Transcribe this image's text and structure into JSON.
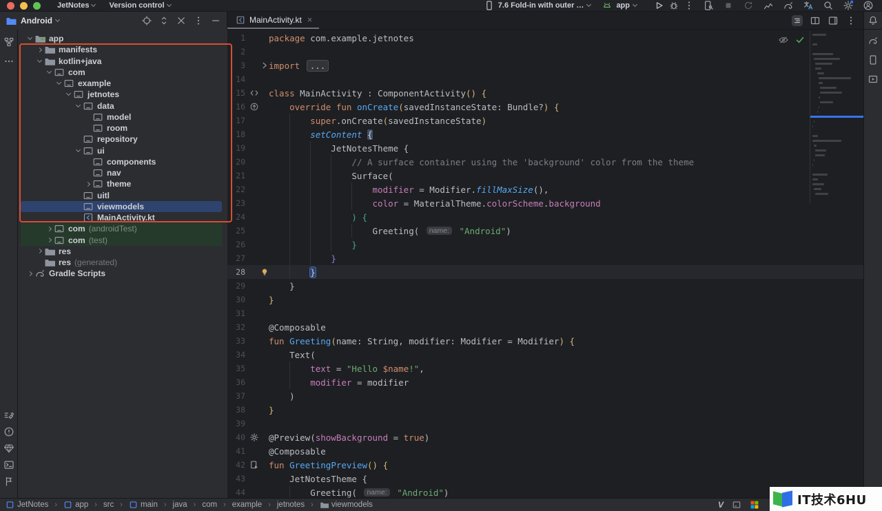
{
  "menubar": {
    "items": [
      "JetNotes",
      "Version control"
    ],
    "device_selector": "7.6 Fold-in with outer …",
    "run_config": "app"
  },
  "project_panel": {
    "title": "Android",
    "tree": [
      {
        "label": "app",
        "level": 0,
        "chev": "down",
        "icon": "app-folder",
        "bold": true
      },
      {
        "label": "manifests",
        "level": 1,
        "chev": "right",
        "icon": "folder"
      },
      {
        "label": "kotlin+java",
        "level": 1,
        "chev": "down",
        "icon": "folder"
      },
      {
        "label": "com",
        "level": 2,
        "chev": "down",
        "icon": "package"
      },
      {
        "label": "example",
        "level": 3,
        "chev": "down",
        "icon": "package"
      },
      {
        "label": "jetnotes",
        "level": 4,
        "chev": "down",
        "icon": "package"
      },
      {
        "label": "data",
        "level": 5,
        "chev": "down",
        "icon": "package"
      },
      {
        "label": "model",
        "level": 6,
        "icon": "package"
      },
      {
        "label": "room",
        "level": 6,
        "icon": "package"
      },
      {
        "label": "repository",
        "level": 5,
        "icon": "package"
      },
      {
        "label": "ui",
        "level": 5,
        "chev": "down",
        "icon": "package"
      },
      {
        "label": "components",
        "level": 6,
        "icon": "package"
      },
      {
        "label": "nav",
        "level": 6,
        "icon": "package"
      },
      {
        "label": "theme",
        "level": 6,
        "chev": "right",
        "icon": "package"
      },
      {
        "label": "uitl",
        "level": 5,
        "icon": "package"
      },
      {
        "label": "viewmodels",
        "level": 5,
        "icon": "package",
        "selected": true
      },
      {
        "label": "MainActivity.kt",
        "level": 5,
        "icon": "kotlin-file"
      },
      {
        "label": "com",
        "suffix": "(androidTest)",
        "level": 2,
        "chev": "right",
        "icon": "package",
        "test": true
      },
      {
        "label": "com",
        "suffix": "(test)",
        "level": 2,
        "chev": "right",
        "icon": "package",
        "test": true
      },
      {
        "label": "res",
        "level": 1,
        "chev": "right",
        "icon": "folder"
      },
      {
        "label": "res",
        "suffix": "(generated)",
        "level": 1,
        "icon": "folder"
      },
      {
        "label": "Gradle Scripts",
        "level": 0,
        "chev": "right",
        "icon": "gradle"
      }
    ]
  },
  "editor": {
    "tab_title": "MainActivity.kt",
    "current_line": "28",
    "lines": [
      {
        "n": "1",
        "tokens": [
          [
            "kw",
            "package"
          ],
          [
            "pl",
            " com.example.jetnotes"
          ]
        ]
      },
      {
        "n": "2",
        "tokens": []
      },
      {
        "n": "3",
        "gutter": "fold",
        "tokens": [
          [
            "kw",
            "import"
          ],
          [
            "pl",
            " "
          ],
          [
            "fold",
            "..."
          ]
        ]
      },
      {
        "n": "14",
        "tokens": []
      },
      {
        "n": "15",
        "gutter": "markup",
        "tokens": [
          [
            "kw",
            "class"
          ],
          [
            "pl",
            " MainActivity : ComponentActivity"
          ],
          [
            "y",
            "()"
          ],
          [
            "pl",
            " "
          ],
          [
            "y",
            "{"
          ]
        ]
      },
      {
        "n": "16",
        "gutter": "override",
        "tokens": [
          [
            "pl",
            "    "
          ],
          [
            "kw",
            "override"
          ],
          [
            "pl",
            " "
          ],
          [
            "kw",
            "fun"
          ],
          [
            "pl",
            " "
          ],
          [
            "def",
            "onCreate"
          ],
          [
            "y",
            "("
          ],
          [
            "pl",
            "savedInstanceState: Bundle?"
          ],
          [
            "y",
            ")"
          ],
          [
            "pl",
            " "
          ],
          [
            "y",
            "{"
          ]
        ]
      },
      {
        "n": "17",
        "tokens": [
          [
            "pl",
            "        "
          ],
          [
            "kw",
            "super"
          ],
          [
            "pl",
            ".onCreate"
          ],
          [
            "y",
            "("
          ],
          [
            "pl",
            "savedInstanceState"
          ],
          [
            "y",
            ")"
          ]
        ]
      },
      {
        "n": "18",
        "tokens": [
          [
            "pl",
            "        "
          ],
          [
            "ext",
            "setContent"
          ],
          [
            "pl",
            " "
          ],
          [
            "mb",
            "{"
          ]
        ]
      },
      {
        "n": "19",
        "tokens": [
          [
            "pl",
            "            JetNotesTheme {"
          ]
        ]
      },
      {
        "n": "20",
        "tokens": [
          [
            "pl",
            "                "
          ],
          [
            "cmt",
            "// A surface container using the 'background' color from the theme"
          ]
        ]
      },
      {
        "n": "21",
        "tokens": [
          [
            "pl",
            "                Surface("
          ]
        ]
      },
      {
        "n": "22",
        "tokens": [
          [
            "pl",
            "                    "
          ],
          [
            "prp",
            "modifier"
          ],
          [
            "pl",
            " = Modifier."
          ],
          [
            "ext",
            "fillMaxSize"
          ],
          [
            "pl",
            "(),"
          ]
        ]
      },
      {
        "n": "23",
        "tokens": [
          [
            "pl",
            "                    "
          ],
          [
            "prp",
            "color"
          ],
          [
            "pl",
            " = MaterialTheme."
          ],
          [
            "prp",
            "colorScheme"
          ],
          [
            "pl",
            "."
          ],
          [
            "prp",
            "background"
          ]
        ]
      },
      {
        "n": "24",
        "tokens": [
          [
            "pl",
            "                "
          ],
          [
            "teal",
            ") {"
          ]
        ]
      },
      {
        "n": "25",
        "tokens": [
          [
            "pl",
            "                    Greeting( "
          ],
          [
            "hint",
            "name:"
          ],
          [
            "pl",
            " "
          ],
          [
            "str",
            "\"Android\""
          ],
          [
            "pl",
            ")"
          ]
        ]
      },
      {
        "n": "26",
        "tokens": [
          [
            "pl",
            "                "
          ],
          [
            "teal",
            "}"
          ]
        ]
      },
      {
        "n": "27",
        "tokens": [
          [
            "pl",
            "            "
          ],
          [
            "vio",
            "}"
          ]
        ]
      },
      {
        "n": "28",
        "gutter": "bulb",
        "tokens": [
          [
            "pl",
            "        "
          ],
          [
            "cb",
            "}"
          ]
        ]
      },
      {
        "n": "29",
        "tokens": [
          [
            "pl",
            "    }"
          ]
        ]
      },
      {
        "n": "30",
        "tokens": [
          [
            "y",
            "}"
          ]
        ]
      },
      {
        "n": "31",
        "tokens": []
      },
      {
        "n": "32",
        "tokens": [
          [
            "pl",
            "@Composable"
          ]
        ]
      },
      {
        "n": "33",
        "tokens": [
          [
            "kw",
            "fun"
          ],
          [
            "pl",
            " "
          ],
          [
            "def",
            "Greeting"
          ],
          [
            "y",
            "("
          ],
          [
            "pl",
            "name: String, modifier: Modifier = Modifier"
          ],
          [
            "y",
            ")"
          ],
          [
            "pl",
            " "
          ],
          [
            "y",
            "{"
          ]
        ]
      },
      {
        "n": "34",
        "tokens": [
          [
            "pl",
            "    Text("
          ]
        ]
      },
      {
        "n": "35",
        "tokens": [
          [
            "pl",
            "        "
          ],
          [
            "prp",
            "text"
          ],
          [
            "pl",
            " = "
          ],
          [
            "str",
            "\"Hello "
          ],
          [
            "tpl",
            "$name"
          ],
          [
            "str",
            "!\""
          ],
          [
            "pl",
            ","
          ]
        ]
      },
      {
        "n": "36",
        "tokens": [
          [
            "pl",
            "        "
          ],
          [
            "prp",
            "modifier"
          ],
          [
            "pl",
            " = modifier"
          ]
        ]
      },
      {
        "n": "37",
        "tokens": [
          [
            "pl",
            "    )"
          ]
        ]
      },
      {
        "n": "38",
        "tokens": [
          [
            "y",
            "}"
          ]
        ]
      },
      {
        "n": "39",
        "tokens": []
      },
      {
        "n": "40",
        "gutter": "gear",
        "tokens": [
          [
            "pl",
            "@Preview("
          ],
          [
            "prp",
            "showBackground"
          ],
          [
            "pl",
            " = "
          ],
          [
            "kw",
            "true"
          ],
          [
            "pl",
            ")"
          ]
        ]
      },
      {
        "n": "41",
        "tokens": [
          [
            "pl",
            "@Composable"
          ]
        ]
      },
      {
        "n": "42",
        "gutter": "runpreview",
        "tokens": [
          [
            "kw",
            "fun"
          ],
          [
            "pl",
            " "
          ],
          [
            "def",
            "GreetingPreview"
          ],
          [
            "y",
            "()"
          ],
          [
            "pl",
            " "
          ],
          [
            "y",
            "{"
          ]
        ]
      },
      {
        "n": "43",
        "tokens": [
          [
            "pl",
            "    JetNotesTheme {"
          ]
        ]
      },
      {
        "n": "44",
        "tokens": [
          [
            "pl",
            "        Greeting( "
          ],
          [
            "hint",
            "name:"
          ],
          [
            "pl",
            " "
          ],
          [
            "str",
            "\"Android\""
          ],
          [
            "pl",
            ")"
          ]
        ]
      }
    ]
  },
  "navbar": {
    "crumbs": [
      {
        "label": "JetNotes",
        "icon": "modsquare"
      },
      {
        "label": "app",
        "icon": "modsquare"
      },
      {
        "label": "src"
      },
      {
        "label": "main",
        "icon": "modsquare"
      },
      {
        "label": "java"
      },
      {
        "label": "com"
      },
      {
        "label": "example"
      },
      {
        "label": "jetnotes"
      },
      {
        "label": "viewmodels",
        "icon": "navfolder"
      }
    ],
    "vcs_glyph": "V"
  },
  "watermark": {
    "text": "IT技术6HU"
  }
}
